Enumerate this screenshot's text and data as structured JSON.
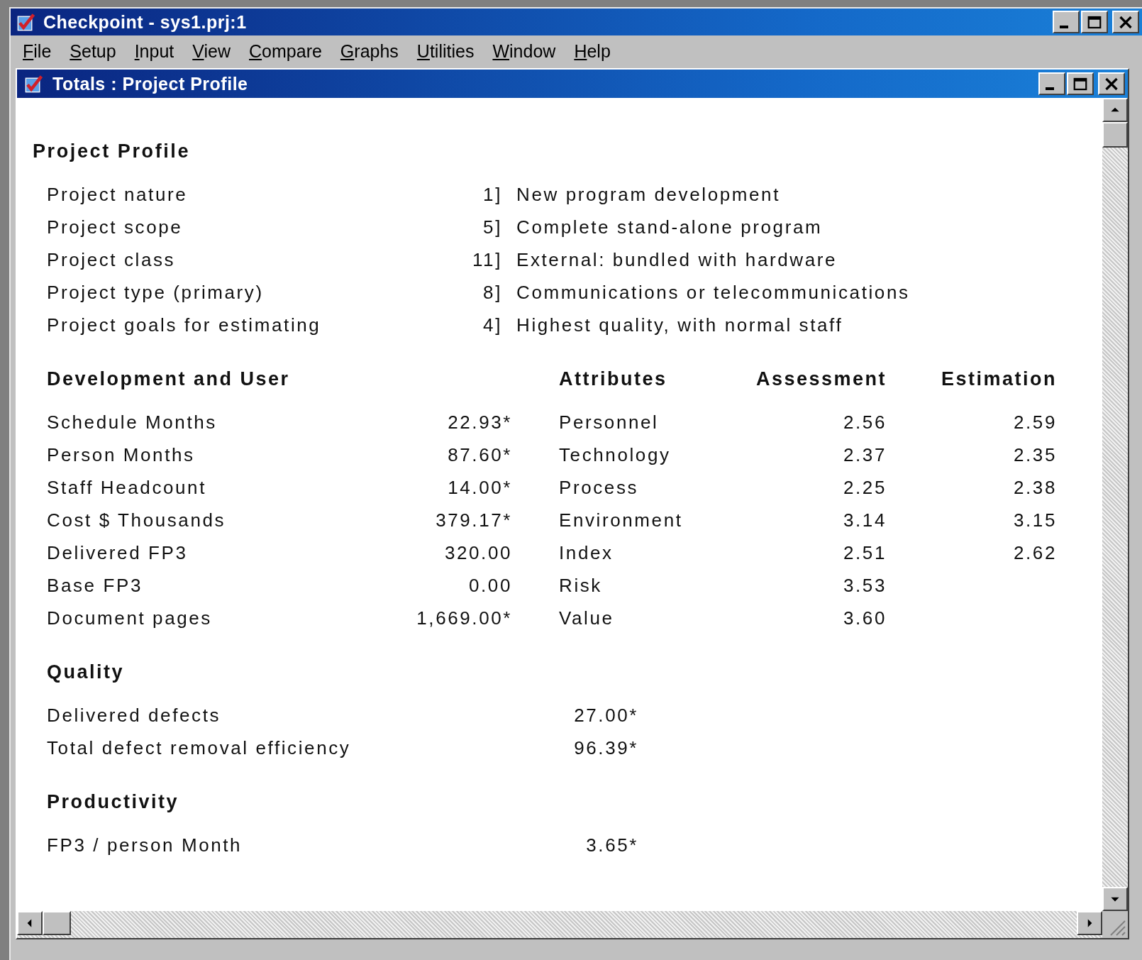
{
  "app_window": {
    "title": "Checkpoint - sys1.prj:1"
  },
  "menu": [
    {
      "label": "File"
    },
    {
      "label": "Setup"
    },
    {
      "label": "Input"
    },
    {
      "label": "View"
    },
    {
      "label": "Compare"
    },
    {
      "label": "Graphs"
    },
    {
      "label": "Utilities"
    },
    {
      "label": "Window"
    },
    {
      "label": "Help"
    }
  ],
  "document_window": {
    "title": "Totals : Project Profile"
  },
  "project_profile": {
    "heading": "Project Profile",
    "rows": [
      {
        "label": "Project nature",
        "code": "1]",
        "value": "New program development"
      },
      {
        "label": "Project scope",
        "code": "5]",
        "value": "Complete stand-alone program"
      },
      {
        "label": "Project class",
        "code": "11]",
        "value": "External: bundled with hardware"
      },
      {
        "label": "Project type (primary)",
        "code": "8]",
        "value": "Communications or telecommunications"
      },
      {
        "label": "Project goals for estimating",
        "code": "4]",
        "value": "Highest quality, with normal staff"
      }
    ]
  },
  "development": {
    "headings": {
      "label": "Development and User",
      "attributes": "Attributes",
      "assessment": "Assessment",
      "estimation": "Estimation"
    },
    "rows": [
      {
        "label": "Schedule Months",
        "value": "22.93*",
        "attribute": "Personnel",
        "assessment": "2.56",
        "estimation": "2.59"
      },
      {
        "label": "Person Months",
        "value": "87.60*",
        "attribute": "Technology",
        "assessment": "2.37",
        "estimation": "2.35"
      },
      {
        "label": "Staff Headcount",
        "value": "14.00*",
        "attribute": "Process",
        "assessment": "2.25",
        "estimation": "2.38"
      },
      {
        "label": "Cost $ Thousands",
        "value": "379.17*",
        "attribute": "Environment",
        "assessment": "3.14",
        "estimation": "3.15"
      },
      {
        "label": "Delivered FP3",
        "value": "320.00",
        "attribute": "Index",
        "assessment": "2.51",
        "estimation": "2.62"
      },
      {
        "label": "Base FP3",
        "value": "0.00",
        "attribute": "Risk",
        "assessment": "3.53"
      },
      {
        "label": "Document pages",
        "value": "1,669.00*",
        "attribute": "Value",
        "assessment": "3.60"
      }
    ]
  },
  "quality": {
    "heading": "Quality",
    "rows": [
      {
        "label": "Delivered defects",
        "value": "27.00*"
      },
      {
        "label": "Total defect removal efficiency",
        "value": "96.39*"
      }
    ]
  },
  "productivity": {
    "heading": "Productivity",
    "rows": [
      {
        "label": "FP3 / person Month",
        "value": "3.65*"
      }
    ]
  }
}
